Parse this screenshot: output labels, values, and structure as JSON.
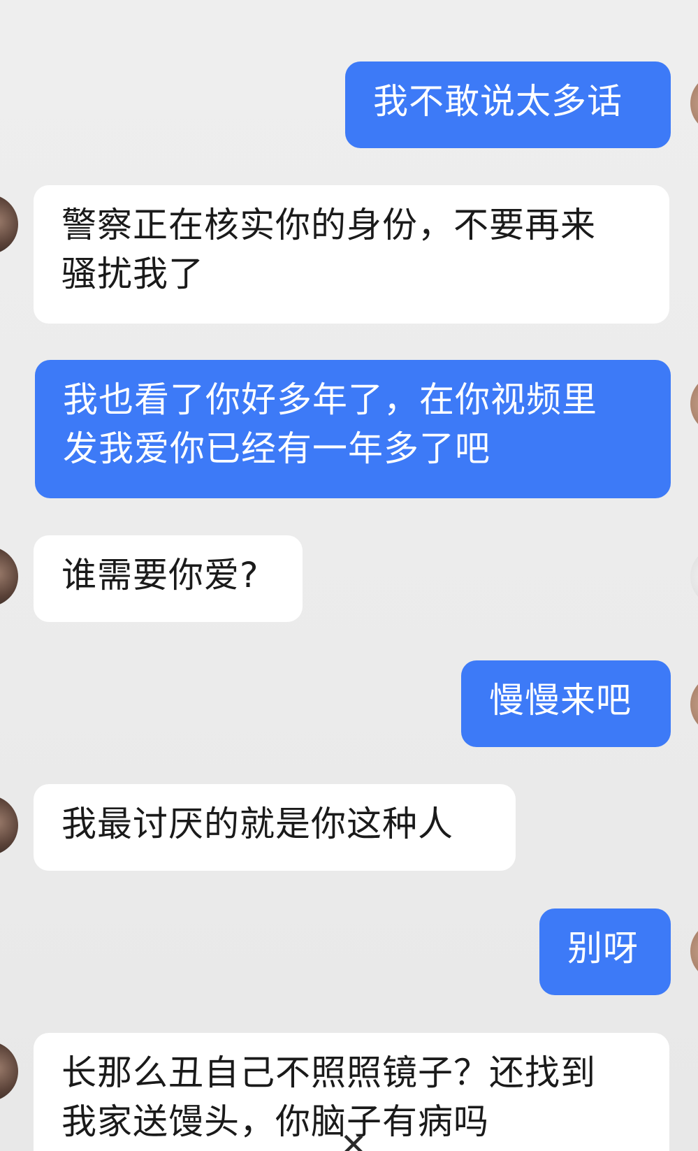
{
  "conversation": {
    "messages": [
      {
        "direction": "outgoing",
        "lines": [
          "我不敢说太多话"
        ]
      },
      {
        "direction": "incoming",
        "lines": [
          "警察正在核实你的身份，不要再来",
          "骚扰我了"
        ]
      },
      {
        "direction": "outgoing",
        "lines": [
          "我也看了你好多年了，在你视频里",
          "发我爱你已经有一年多了吧"
        ]
      },
      {
        "direction": "incoming",
        "lines": [
          "谁需要你爱?"
        ]
      },
      {
        "direction": "outgoing",
        "lines": [
          "慢慢来吧"
        ]
      },
      {
        "direction": "incoming",
        "lines": [
          "我最讨厌的就是你这种人"
        ]
      },
      {
        "direction": "outgoing",
        "lines": [
          "别呀"
        ]
      },
      {
        "direction": "incoming",
        "lines": [
          "长那么丑自己不照照镜子？还找到",
          "我家送馒头，你脑子有病吗"
        ]
      }
    ]
  },
  "colors": {
    "outgoing_bubble": "#3d7af7",
    "incoming_bubble": "#ffffff",
    "background": "#ededed"
  },
  "icons": {
    "overlay_close": "close-icon"
  }
}
